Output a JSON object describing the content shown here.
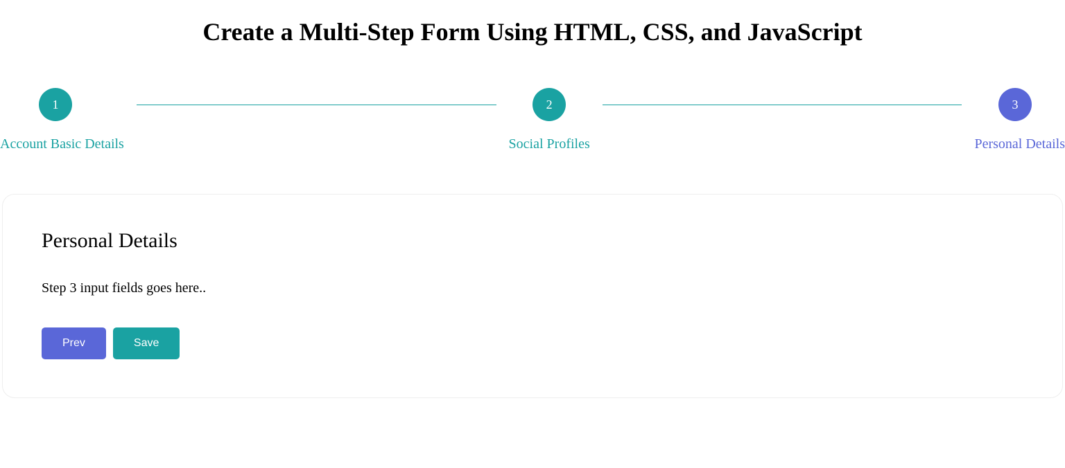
{
  "title": "Create a Multi-Step Form Using HTML, CSS, and JavaScript",
  "stepper": {
    "steps": [
      {
        "number": "1",
        "label": "Account Basic Details",
        "state": "teal"
      },
      {
        "number": "2",
        "label": "Social Profiles",
        "state": "teal"
      },
      {
        "number": "3",
        "label": "Personal Details",
        "state": "indigo"
      }
    ]
  },
  "card": {
    "heading": "Personal Details",
    "body_text": "Step 3 input fields goes here..",
    "buttons": {
      "prev_label": "Prev",
      "save_label": "Save"
    }
  },
  "colors": {
    "teal": "#1aa2a2",
    "indigo": "#5a67d8"
  }
}
